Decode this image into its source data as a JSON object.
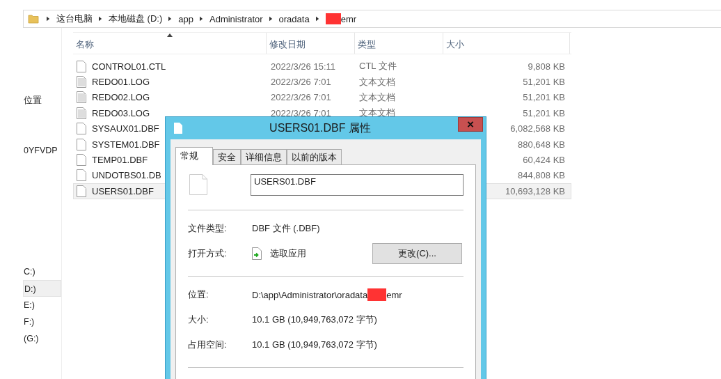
{
  "breadcrumb": [
    {
      "label": "这台电脑",
      "redacted": false
    },
    {
      "label": "本地磁盘 (D:)",
      "redacted": false
    },
    {
      "label": "app",
      "redacted": false
    },
    {
      "label": "Administrator",
      "redacted": false
    },
    {
      "label": "oradata",
      "redacted": false
    },
    {
      "label": "emr",
      "redacted": true
    }
  ],
  "sidebar": {
    "items": [
      {
        "label": "位置",
        "selected": false
      },
      {
        "label": "0YFVDP",
        "selected": false
      },
      {
        "label": "C:)",
        "selected": false
      },
      {
        "label": "D:)",
        "selected": true
      },
      {
        "label": "E:)",
        "selected": false
      },
      {
        "label": "F:)",
        "selected": false
      },
      {
        "label": "(G:)",
        "selected": false
      }
    ]
  },
  "file_list": {
    "columns": [
      {
        "label": "名称",
        "sorted": true
      },
      {
        "label": "修改日期",
        "sorted": false
      },
      {
        "label": "类型",
        "sorted": false
      },
      {
        "label": "大小",
        "sorted": false
      }
    ],
    "rows": [
      {
        "name": "CONTROL01.CTL",
        "modified": "2022/3/26 15:11",
        "type": "CTL 文件",
        "size": "9,808 KB",
        "kind": "blank",
        "selected": false
      },
      {
        "name": "REDO01.LOG",
        "modified": "2022/3/26 7:01",
        "type": "文本文档",
        "size": "51,201 KB",
        "kind": "text",
        "selected": false
      },
      {
        "name": "REDO02.LOG",
        "modified": "2022/3/26 7:01",
        "type": "文本文档",
        "size": "51,201 KB",
        "kind": "text",
        "selected": false
      },
      {
        "name": "REDO03.LOG",
        "modified": "2022/3/26 7:01",
        "type": "文本文档",
        "size": "51,201 KB",
        "kind": "text",
        "selected": false
      },
      {
        "name": "SYSAUX01.DBF",
        "size": "6,082,568 KB",
        "kind": "blank",
        "selected": false
      },
      {
        "name": "SYSTEM01.DBF",
        "size": "880,648 KB",
        "kind": "blank",
        "selected": false
      },
      {
        "name": "TEMP01.DBF",
        "size": "60,424 KB",
        "kind": "blank",
        "selected": false
      },
      {
        "name": "UNDOTBS01.DB",
        "size": "844,808 KB",
        "kind": "blank",
        "selected": false
      },
      {
        "name": "USERS01.DBF",
        "size": "10,693,128 KB",
        "kind": "blank",
        "selected": true
      }
    ]
  },
  "dialog": {
    "title": "USERS01.DBF 属性",
    "tabs": [
      {
        "label": "常规",
        "selected": true
      },
      {
        "label": "安全",
        "selected": false
      },
      {
        "label": "详细信息",
        "selected": false
      },
      {
        "label": "以前的版本",
        "selected": false
      }
    ],
    "file_name": "USERS01.DBF",
    "sections": [
      [
        {
          "kind": "text",
          "label": "文件类型:",
          "value": "DBF 文件 (.DBF)"
        },
        {
          "kind": "app",
          "label": "打开方式:",
          "value": "选取应用",
          "button": "更改(C)..."
        }
      ],
      [
        {
          "kind": "redacted",
          "label": "位置:",
          "value": "D:\\app\\Administrator\\oradata",
          "value_after": "emr"
        },
        {
          "kind": "text",
          "label": "大小:",
          "value": "10.1 GB (10,949,763,072 字节)"
        },
        {
          "kind": "text",
          "label": "占用空间:",
          "value": "10.1 GB (10,949,763,072 字节)"
        }
      ]
    ]
  }
}
